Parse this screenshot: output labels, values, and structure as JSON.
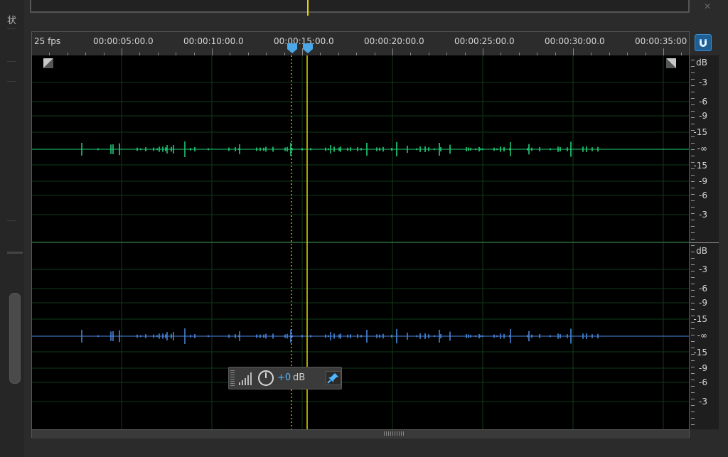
{
  "left_panel": {
    "glyph": "状"
  },
  "ruler": {
    "fps_label": "25 fps",
    "time_labels": [
      "00:00:05:00.0",
      "00:00:10:00.0",
      "00:00:15:00.0",
      "00:00:20:00.0",
      "00:00:25:00.0",
      "00:00:30:00.0",
      "00:00:35:00"
    ]
  },
  "db_scale": {
    "unit": "dB",
    "labels": [
      "-3",
      "-6",
      "-9",
      "-15",
      "-∞",
      "-15",
      "-9",
      "-6",
      "-3"
    ]
  },
  "gain_hud": {
    "value": "+0",
    "unit": "dB"
  },
  "icons": {
    "magnet": "magnet-icon",
    "volume_bars": "volume-bars-icon",
    "knob": "power-knob-icon",
    "pin": "pin-icon"
  },
  "colors": {
    "left_channel": "#22d07a",
    "right_channel": "#4a88e0",
    "playhead": "#e8d400",
    "marker": "#4aa8e8"
  }
}
